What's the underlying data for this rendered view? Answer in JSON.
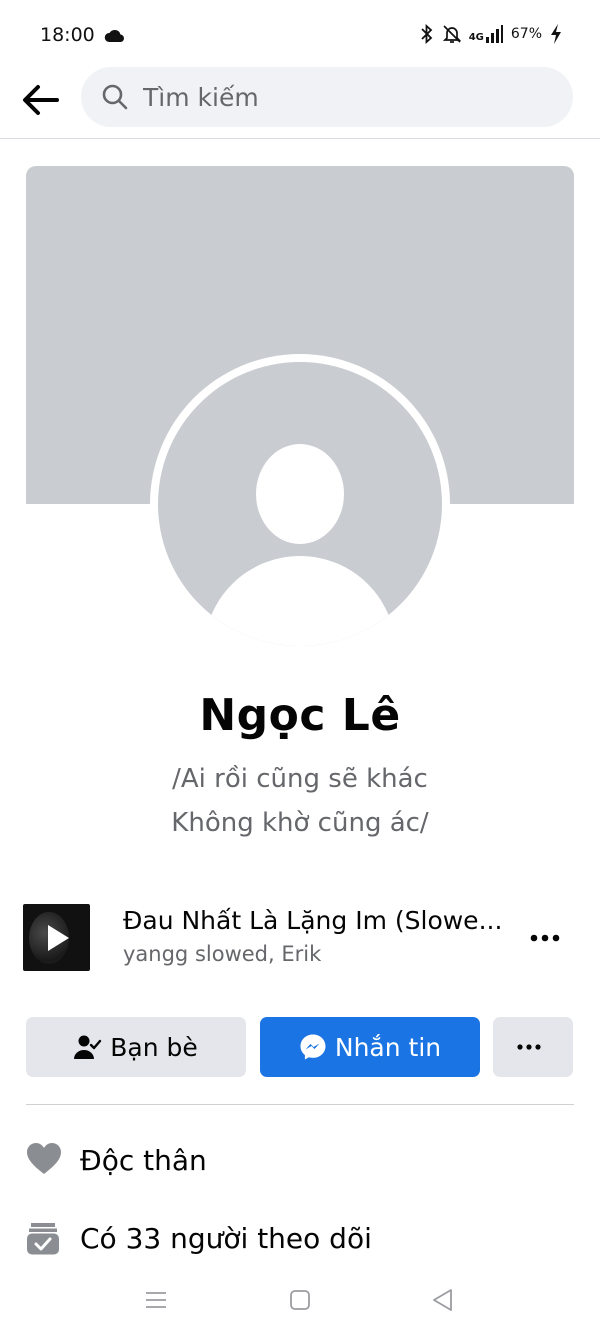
{
  "status_bar": {
    "time": "18:00",
    "network": "4G",
    "battery": "67%"
  },
  "header": {
    "search_placeholder": "Tìm kiếm"
  },
  "profile": {
    "name": "Ngọc Lê",
    "bio_line_1": "/Ai rồi cũng sẽ khác",
    "bio_line_2": "Không khờ cũng ác/"
  },
  "music": {
    "title": "Đau Nhất Là Lặng Im (Slowe...",
    "artist": "yangg slowed,  Erik"
  },
  "actions": {
    "friends_label": "Bạn bè",
    "message_label": "Nhắn tin"
  },
  "details": {
    "relationship": "Độc thân",
    "followers": "Có 33 người theo dõi"
  },
  "colors": {
    "accent": "#1b74e4",
    "secondary_text": "#65676b",
    "button_gray": "#e4e6eb",
    "placeholder_gray": "#c9ccd1"
  },
  "icons": {
    "back": "arrow-left-icon",
    "search": "search-icon",
    "friends": "person-check-icon",
    "messenger": "messenger-icon",
    "more": "more-horizontal-icon",
    "relationship": "heart-icon",
    "followers": "followers-icon"
  }
}
